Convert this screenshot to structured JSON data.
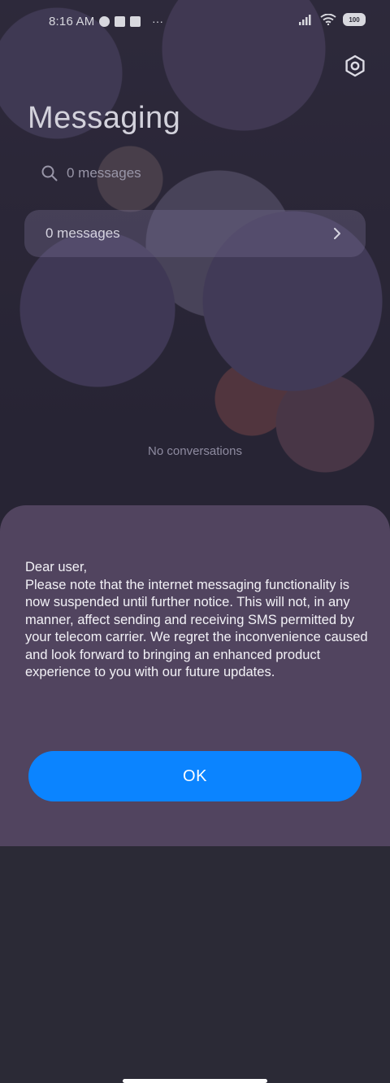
{
  "status_bar": {
    "time": "8:16 AM",
    "battery": "100",
    "more": "···"
  },
  "header": {
    "title": "Messaging",
    "settings_icon": "gear-icon"
  },
  "search": {
    "placeholder": "0 messages"
  },
  "summary": {
    "label": "0 messages"
  },
  "empty_state": "No conversations",
  "dialog": {
    "message": "Dear user,\nPlease note that the internet messaging functionality is now suspended until further notice. This will not, in any manner, affect sending and receiving SMS permitted by your telecom carrier. We regret the inconvenience caused and look forward to bringing an enhanced product experience to you with our future updates.",
    "ok_label": "OK"
  },
  "colors": {
    "accent": "#0b84ff",
    "dialog_bg": "#51445f"
  }
}
